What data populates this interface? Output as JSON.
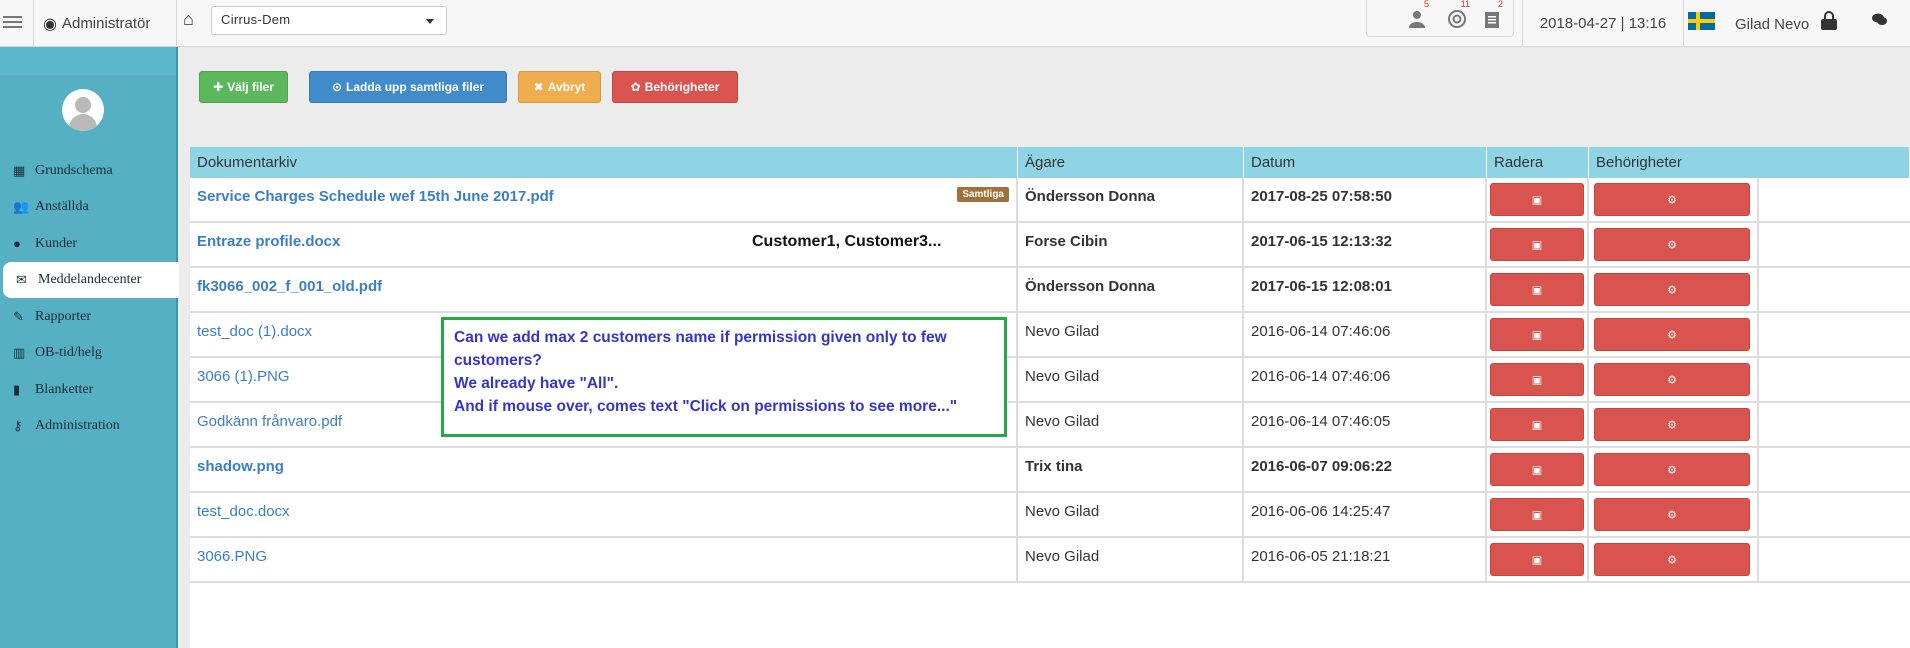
{
  "topbar": {
    "role": "Administratör",
    "company": "Cirrus-Dem",
    "badges": [
      "5",
      "11",
      "2"
    ],
    "datetime": "2018-04-27 | 13:16",
    "user": "Gilad Nevo"
  },
  "sidebar": {
    "items": [
      {
        "label": "Grundschema",
        "icon": "calendar-icon"
      },
      {
        "label": "Anställda",
        "icon": "users-icon"
      },
      {
        "label": "Kunder",
        "icon": "user-icon"
      },
      {
        "label": "Meddelandecenter",
        "icon": "envelope-icon",
        "active": true
      },
      {
        "label": "Rapporter",
        "icon": "pencil-icon"
      },
      {
        "label": "OB-tid/helg",
        "icon": "chart-icon"
      },
      {
        "label": "Blanketter",
        "icon": "file-icon"
      },
      {
        "label": "Administration",
        "icon": "key-icon"
      }
    ]
  },
  "toolbar": {
    "choose_files": "Välj filer",
    "upload_all": "Ladda upp samtliga filer",
    "cancel": "Avbryt",
    "permissions": "Behörigheter"
  },
  "table": {
    "headers": [
      "Dokumentarkiv",
      "Ägare",
      "Datum",
      "Radera",
      "Behörigheter"
    ],
    "rows": [
      {
        "doc": "Service Charges Schedule wef 15th June 2017.pdf",
        "owner": "Öndersson Donna",
        "date": "2017-08-25 07:58:50",
        "bold": true,
        "badge": "Samtliga"
      },
      {
        "doc": "Entraze profile.docx",
        "owner": "Forse Cibin",
        "date": "2017-06-15 12:13:32",
        "bold": true,
        "customers": "Customer1, Customer3..."
      },
      {
        "doc": "fk3066_002_f_001_old.pdf",
        "owner": "Öndersson Donna",
        "date": "2017-06-15 12:08:01",
        "bold": true
      },
      {
        "doc": "test_doc (1).docx",
        "owner": "Nevo Gilad",
        "date": "2016-06-14 07:46:06",
        "bold": false
      },
      {
        "doc": "3066 (1).PNG",
        "owner": "Nevo Gilad",
        "date": "2016-06-14 07:46:06",
        "bold": false
      },
      {
        "doc": "Godkänn frånvaro.pdf",
        "owner": "Nevo Gilad",
        "date": "2016-06-14 07:46:05",
        "bold": false
      },
      {
        "doc": "shadow.png",
        "owner": "Trix tina",
        "date": "2016-06-07 09:06:22",
        "bold": true
      },
      {
        "doc": "test_doc.docx",
        "owner": "Nevo Gilad",
        "date": "2016-06-06 14:25:47",
        "bold": false
      },
      {
        "doc": "3066.PNG",
        "owner": "Nevo Gilad",
        "date": "2016-06-05 21:18:21",
        "bold": false
      }
    ]
  },
  "annotation": {
    "lines": [
      "Can we add max 2 customers name if permission given only to few",
      "customers?",
      "We already have \"All\".",
      "And if mouse over, comes text \"Click on permissions to see more...\""
    ]
  }
}
